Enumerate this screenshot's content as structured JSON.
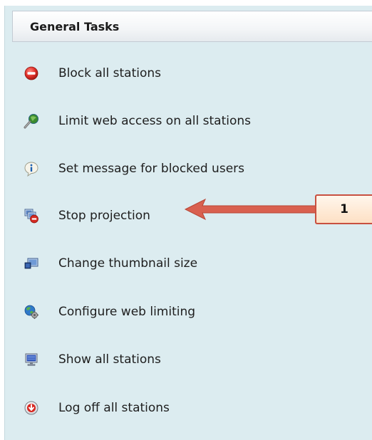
{
  "panel": {
    "title": "General Tasks",
    "tasks": [
      {
        "label": "Block all stations",
        "icon": "block-icon"
      },
      {
        "label": "Limit web access on all stations",
        "icon": "web-limit-icon"
      },
      {
        "label": "Set message for blocked users",
        "icon": "info-icon"
      },
      {
        "label": "Stop projection",
        "icon": "stop-projection-icon"
      },
      {
        "label": "Change thumbnail size",
        "icon": "thumbnail-icon"
      },
      {
        "label": "Configure web limiting",
        "icon": "globe-gear-icon"
      },
      {
        "label": "Show all stations",
        "icon": "monitor-icon"
      },
      {
        "label": "Log off all stations",
        "icon": "logoff-icon"
      }
    ]
  },
  "callout": {
    "number": "1",
    "color": "#d9604f"
  }
}
